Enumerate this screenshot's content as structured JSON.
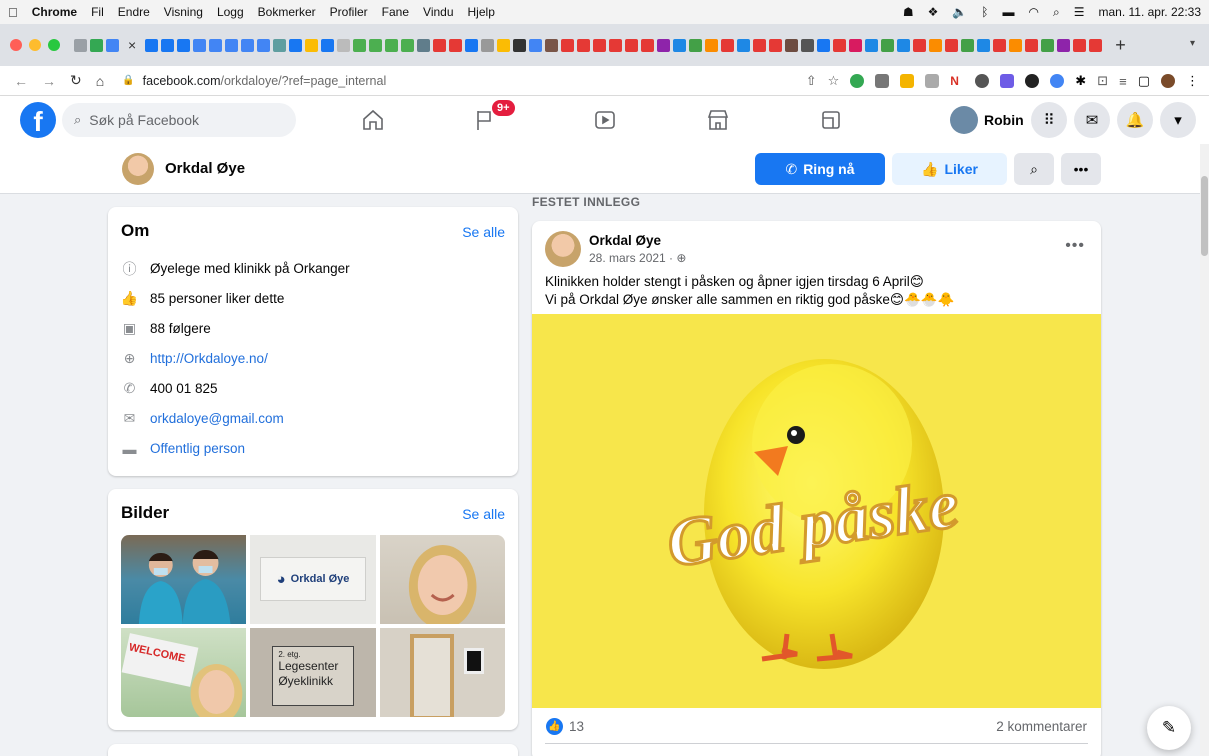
{
  "menubar": {
    "apple": "",
    "app": "Chrome",
    "items": [
      "Fil",
      "Endre",
      "Visning",
      "Logg",
      "Bokmerker",
      "Profiler",
      "Fane",
      "Vindu",
      "Hjelp"
    ],
    "clock": "man. 11. apr. 22:33"
  },
  "browser": {
    "url_domain": "facebook.com",
    "url_path": "/orkdaloye/?ref=page_internal",
    "new_tab": "+"
  },
  "fb": {
    "search_placeholder": "Søk på Facebook",
    "notif_badge": "9+",
    "profile_name": "Robin"
  },
  "page": {
    "name": "Orkdal Øye",
    "call_button": "Ring nå",
    "like_button": "Liker"
  },
  "about": {
    "title": "Om",
    "see_all": "Se alle",
    "description": "Øyelege med klinikk på Orkanger",
    "likes": "85 personer liker dette",
    "followers": "88 følgere",
    "website": "http://Orkdaloye.no/",
    "phone": "400 01 825",
    "email": "orkdaloye@gmail.com",
    "category": "Offentlig person"
  },
  "photos": {
    "title": "Bilder",
    "see_all": "Se alle",
    "sign_text": "Orkdal Øye",
    "welcome_text": "WELCOME",
    "board_floor": "2. etg.",
    "board_line1": "Legesenter",
    "board_line2": "Øyeklinikk"
  },
  "post": {
    "pinned_label": "FESTET INNLEGG",
    "author": "Orkdal Øye",
    "date": "28. mars 2021 · ",
    "line1": "Klinikken holder stengt i påsken og åpner igjen tirsdag 6 April😊",
    "line2": "Vi på Orkdal Øye ønsker alle sammen en riktig god påske😊🐣🐣🐥",
    "image_text": "God påske",
    "like_count": "13",
    "comments": "2 kommentarer"
  },
  "colors": {
    "brand": "#1877f2",
    "background": "#f0f2f5",
    "post_image_bg": "#f7e64b"
  }
}
